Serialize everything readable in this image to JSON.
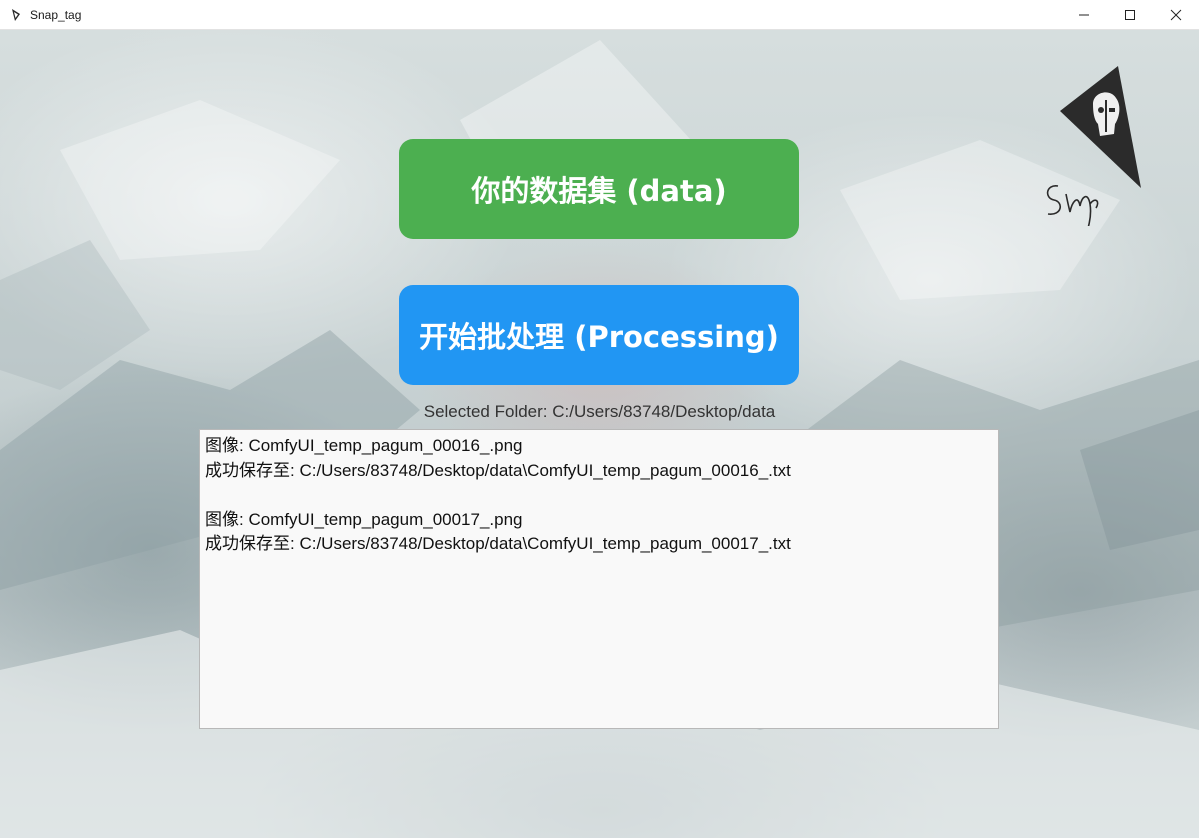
{
  "window": {
    "title": "Snap_tag",
    "controls": {
      "minimize_icon": "minimize-icon",
      "maximize_icon": "maximize-icon",
      "close_icon": "close-icon"
    }
  },
  "main": {
    "dataset_button": {
      "label": "你的数据集 (data)",
      "color": "#4caf50"
    },
    "process_button": {
      "label": "开始批处理 (Processing)",
      "color": "#2196f3"
    },
    "selected_folder": "Selected Folder: C:/Users/83748/Desktop/data",
    "logo": {
      "icon": "snap-logo-icon"
    },
    "log": {
      "lines": [
        "图像: ComfyUI_temp_pagum_00016_.png",
        "成功保存至: C:/Users/83748/Desktop/data\\ComfyUI_temp_pagum_00016_.txt",
        "",
        "图像: ComfyUI_temp_pagum_00017_.png",
        "成功保存至: C:/Users/83748/Desktop/data\\ComfyUI_temp_pagum_00017_.txt"
      ]
    }
  }
}
